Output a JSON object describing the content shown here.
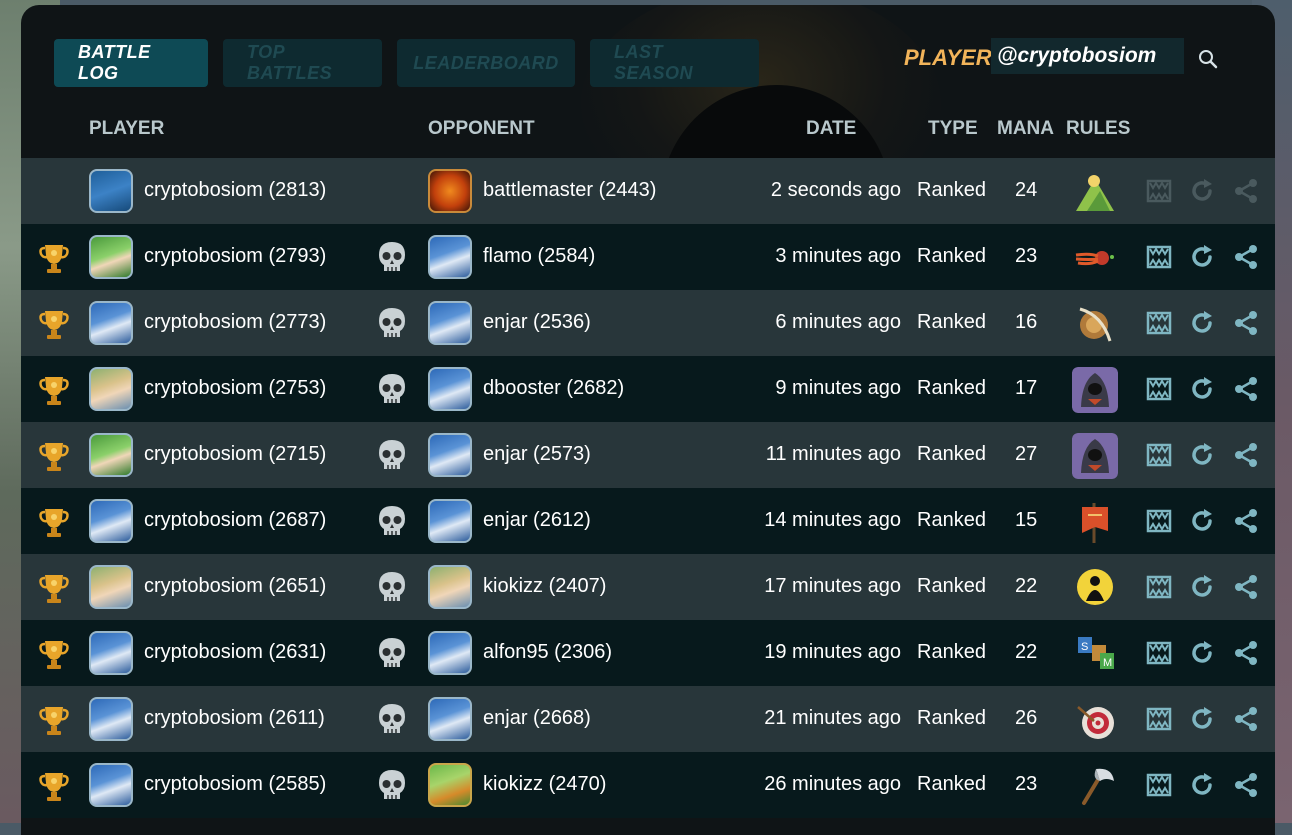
{
  "tabs": [
    {
      "label": "BATTLE LOG",
      "active": true
    },
    {
      "label": "TOP BATTLES",
      "active": false
    },
    {
      "label": "LEADERBOARD",
      "active": false
    },
    {
      "label": "LAST SEASON",
      "active": false
    }
  ],
  "player": {
    "label": "PLAYER:",
    "value": "@cryptobosiom"
  },
  "headers": {
    "player": "PLAYER",
    "opponent": "OPPONENT",
    "date": "DATE",
    "type": "TYPE",
    "mana": "MANA",
    "rules": "RULES"
  },
  "colors": {
    "accent_orange": "#f2b45a",
    "teal": "#7fb6c2",
    "row_dark": "#07191c",
    "row_light": "#28363a"
  },
  "rows": [
    {
      "winner": false,
      "loser": false,
      "player_avatar": "cmb-badge",
      "player": "cryptobosiom (2813)",
      "opponent_avatar": "dragon-emblem",
      "opponent": "battlemaster (2443)",
      "date": "2 seconds ago",
      "type": "Ranked",
      "mana": "24",
      "rule_icon": "mountain-rule-icon",
      "actions_enabled": false
    },
    {
      "winner": true,
      "loser": true,
      "player_avatar": "green-hair-hero",
      "player": "cryptobosiom (2793)",
      "opponent_avatar": "wizard",
      "opponent": "flamo (2584)",
      "date": "3 minutes ago",
      "type": "Ranked",
      "mana": "23",
      "rule_icon": "comet-rule-icon",
      "actions_enabled": true
    },
    {
      "winner": true,
      "loser": true,
      "player_avatar": "wizard",
      "player": "cryptobosiom (2773)",
      "opponent_avatar": "wizard",
      "opponent": "enjar (2536)",
      "date": "6 minutes ago",
      "type": "Ranked",
      "mana": "16",
      "rule_icon": "shield-bow-rule-icon",
      "actions_enabled": true
    },
    {
      "winner": true,
      "loser": true,
      "player_avatar": "blond-hero",
      "player": "cryptobosiom (2753)",
      "opponent_avatar": "wizard",
      "opponent": "dbooster (2682)",
      "date": "9 minutes ago",
      "type": "Ranked",
      "mana": "17",
      "rule_icon": "hooded-figure-rule-icon",
      "actions_enabled": true
    },
    {
      "winner": true,
      "loser": true,
      "player_avatar": "green-hair-hero",
      "player": "cryptobosiom (2715)",
      "opponent_avatar": "wizard",
      "opponent": "enjar (2573)",
      "date": "11 minutes ago",
      "type": "Ranked",
      "mana": "27",
      "rule_icon": "hooded-figure-rule-icon",
      "actions_enabled": true
    },
    {
      "winner": true,
      "loser": true,
      "player_avatar": "wizard",
      "player": "cryptobosiom (2687)",
      "opponent_avatar": "wizard",
      "opponent": "enjar (2612)",
      "date": "14 minutes ago",
      "type": "Ranked",
      "mana": "15",
      "rule_icon": "banner-rule-icon",
      "actions_enabled": true
    },
    {
      "winner": true,
      "loser": true,
      "player_avatar": "blond-hero",
      "player": "cryptobosiom (2651)",
      "opponent_avatar": "blond-hero",
      "opponent": "kiokizz (2407)",
      "date": "17 minutes ago",
      "type": "Ranked",
      "mana": "22",
      "rule_icon": "moon-silhouette-rule-icon",
      "actions_enabled": true
    },
    {
      "winner": true,
      "loser": true,
      "player_avatar": "wizard",
      "player": "cryptobosiom (2631)",
      "opponent_avatar": "wizard",
      "opponent": "alfon95 (2306)",
      "date": "19 minutes ago",
      "type": "Ranked",
      "mana": "22",
      "rule_icon": "letter-cards-rule-icon",
      "actions_enabled": true
    },
    {
      "winner": true,
      "loser": true,
      "player_avatar": "wizard",
      "player": "cryptobosiom (2611)",
      "opponent_avatar": "wizard",
      "opponent": "enjar (2668)",
      "date": "21 minutes ago",
      "type": "Ranked",
      "mana": "26",
      "rule_icon": "target-rule-icon",
      "actions_enabled": true
    },
    {
      "winner": true,
      "loser": true,
      "player_avatar": "wizard",
      "player": "cryptobosiom (2585)",
      "opponent_avatar": "orc-hero",
      "opponent": "kiokizz (2470)",
      "date": "26 minutes ago",
      "type": "Ranked",
      "mana": "23",
      "rule_icon": "axe-rule-icon",
      "actions_enabled": true
    }
  ]
}
